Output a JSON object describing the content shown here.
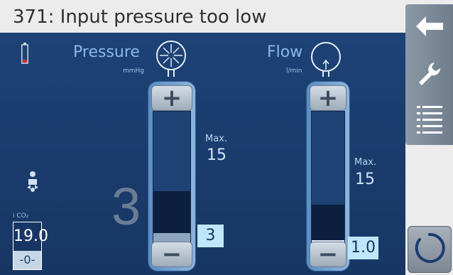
{
  "title": "371: Input pressure too low",
  "pressure": {
    "label": "Pressure",
    "unit": "mmHg",
    "max_label": "Max.",
    "max_value": "15",
    "big_value": "3",
    "set_value": "3",
    "plus": "+",
    "minus": "−",
    "fill_fraction": 0.4
  },
  "flow": {
    "label": "Flow",
    "unit": "l/min",
    "max_label": "Max.",
    "max_value": "15",
    "set_value": "1.0",
    "plus": "+",
    "minus": "−",
    "fill_fraction": 0.3
  },
  "co2": {
    "label": "i CO₂",
    "value": "19.0",
    "sub_value": "-0-"
  },
  "icons": {
    "battery": "battery-icon",
    "infant": "infant-icon",
    "back": "back-arrow-icon",
    "wrench": "wrench-icon",
    "menu": "menu-list-icon",
    "power": "power-icon"
  },
  "colors": {
    "background": "#1a3c70",
    "title_bar": "#ececec",
    "set_value_box": "#bfe6fb",
    "battery_low": "#d0302f"
  }
}
